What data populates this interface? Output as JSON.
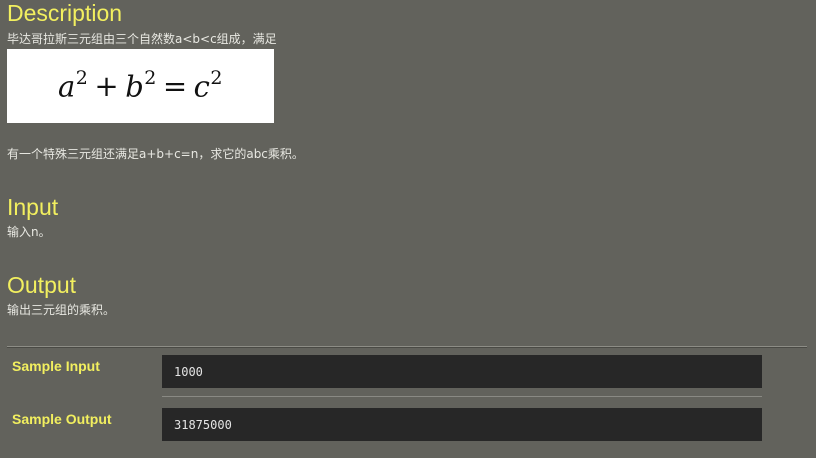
{
  "description": {
    "heading": "Description",
    "intro": "毕达哥拉斯三元组由三个自然数a<b<c组成，满足",
    "formula": {
      "a": "a",
      "b": "b",
      "c": "c",
      "exp": "2",
      "plus": "+",
      "equals": "="
    },
    "detail": "有一个特殊三元组还满足a+b+c=n，求它的abc乘积。"
  },
  "input": {
    "heading": "Input",
    "text": "输入n。"
  },
  "output": {
    "heading": "Output",
    "text": "输出三元组的乘积。"
  },
  "samples": {
    "input_label": "Sample Input",
    "input_value": "1000",
    "output_label": "Sample Output",
    "output_value": "31875000"
  }
}
